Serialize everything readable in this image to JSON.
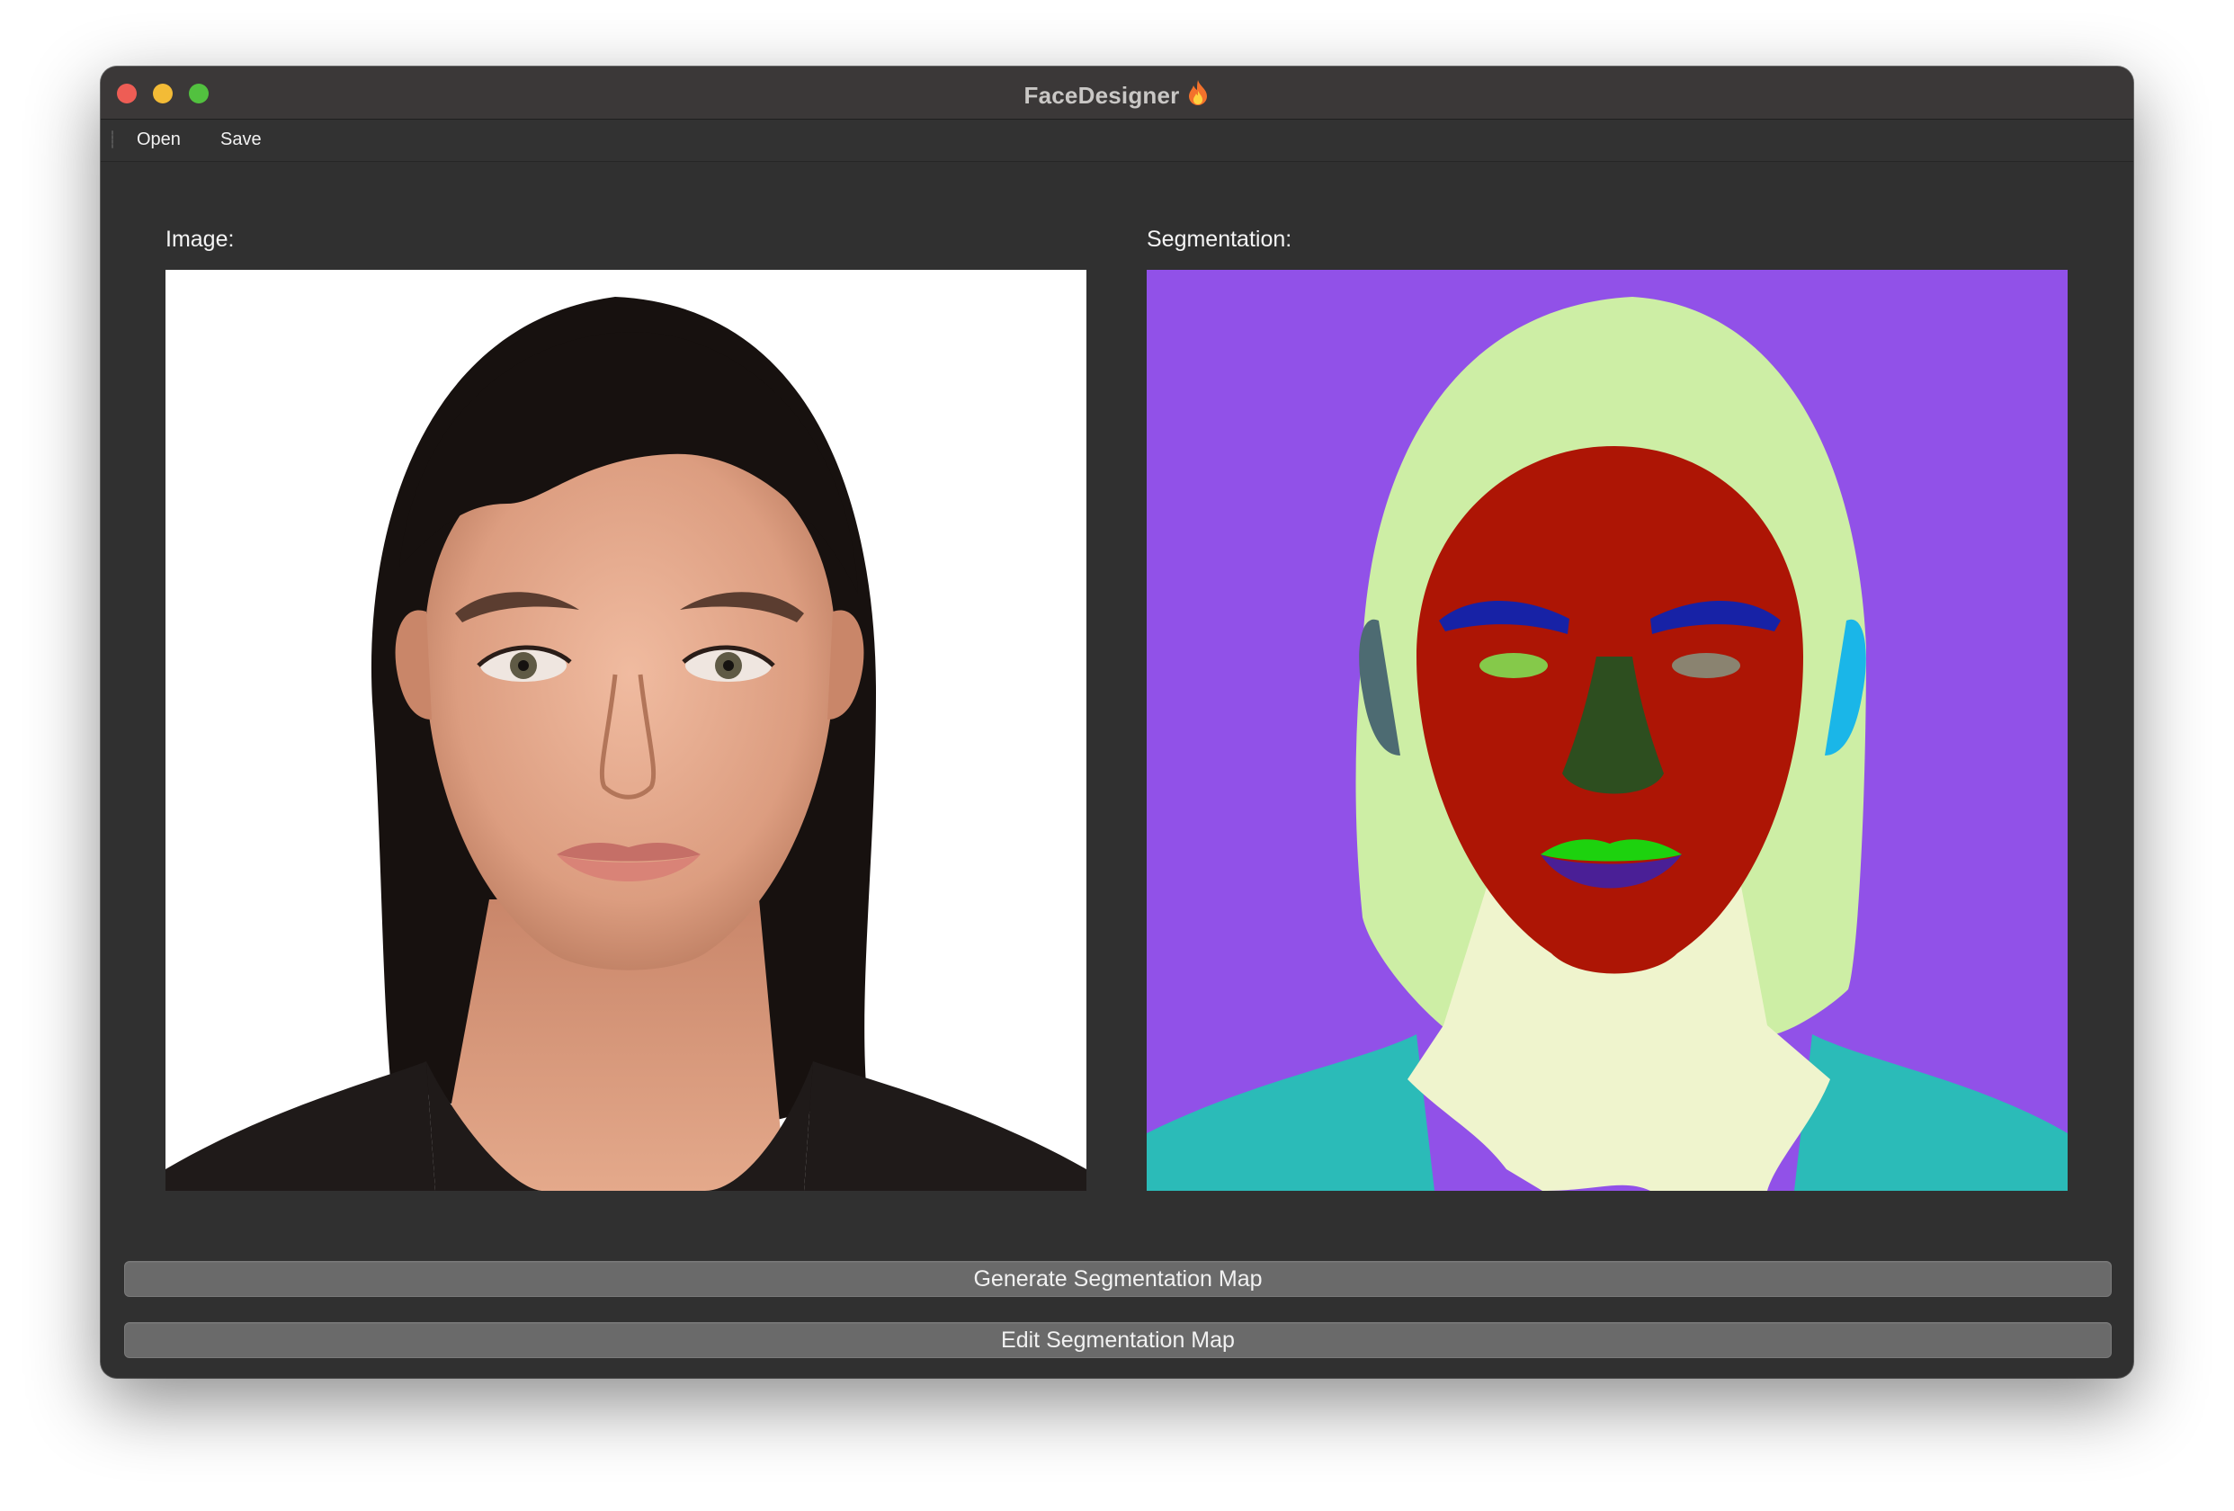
{
  "window": {
    "title": "FaceDesigner",
    "title_icon": "fire-emoji"
  },
  "menu": {
    "open_label": "Open",
    "save_label": "Save"
  },
  "panels": {
    "image_label": "Image:",
    "segmentation_label": "Segmentation:"
  },
  "buttons": {
    "generate_label": "Generate Segmentation Map",
    "edit_label": "Edit Segmentation Map"
  },
  "segmentation_colors": {
    "background": "#9151e8",
    "hair": "#cdeea5",
    "skin": "#ad1505",
    "neck": "#eff4cd",
    "clothing": "#2bbbb8",
    "brows": "#1722a6",
    "left_eye": "#85c94a",
    "right_eye": "#8a8370",
    "nose": "#2d4e1f",
    "upper_lip": "#1dd20e",
    "lower_lip": "#4a1f96",
    "left_ear": "#4d6b72",
    "right_ear": "#1ab6e8"
  }
}
